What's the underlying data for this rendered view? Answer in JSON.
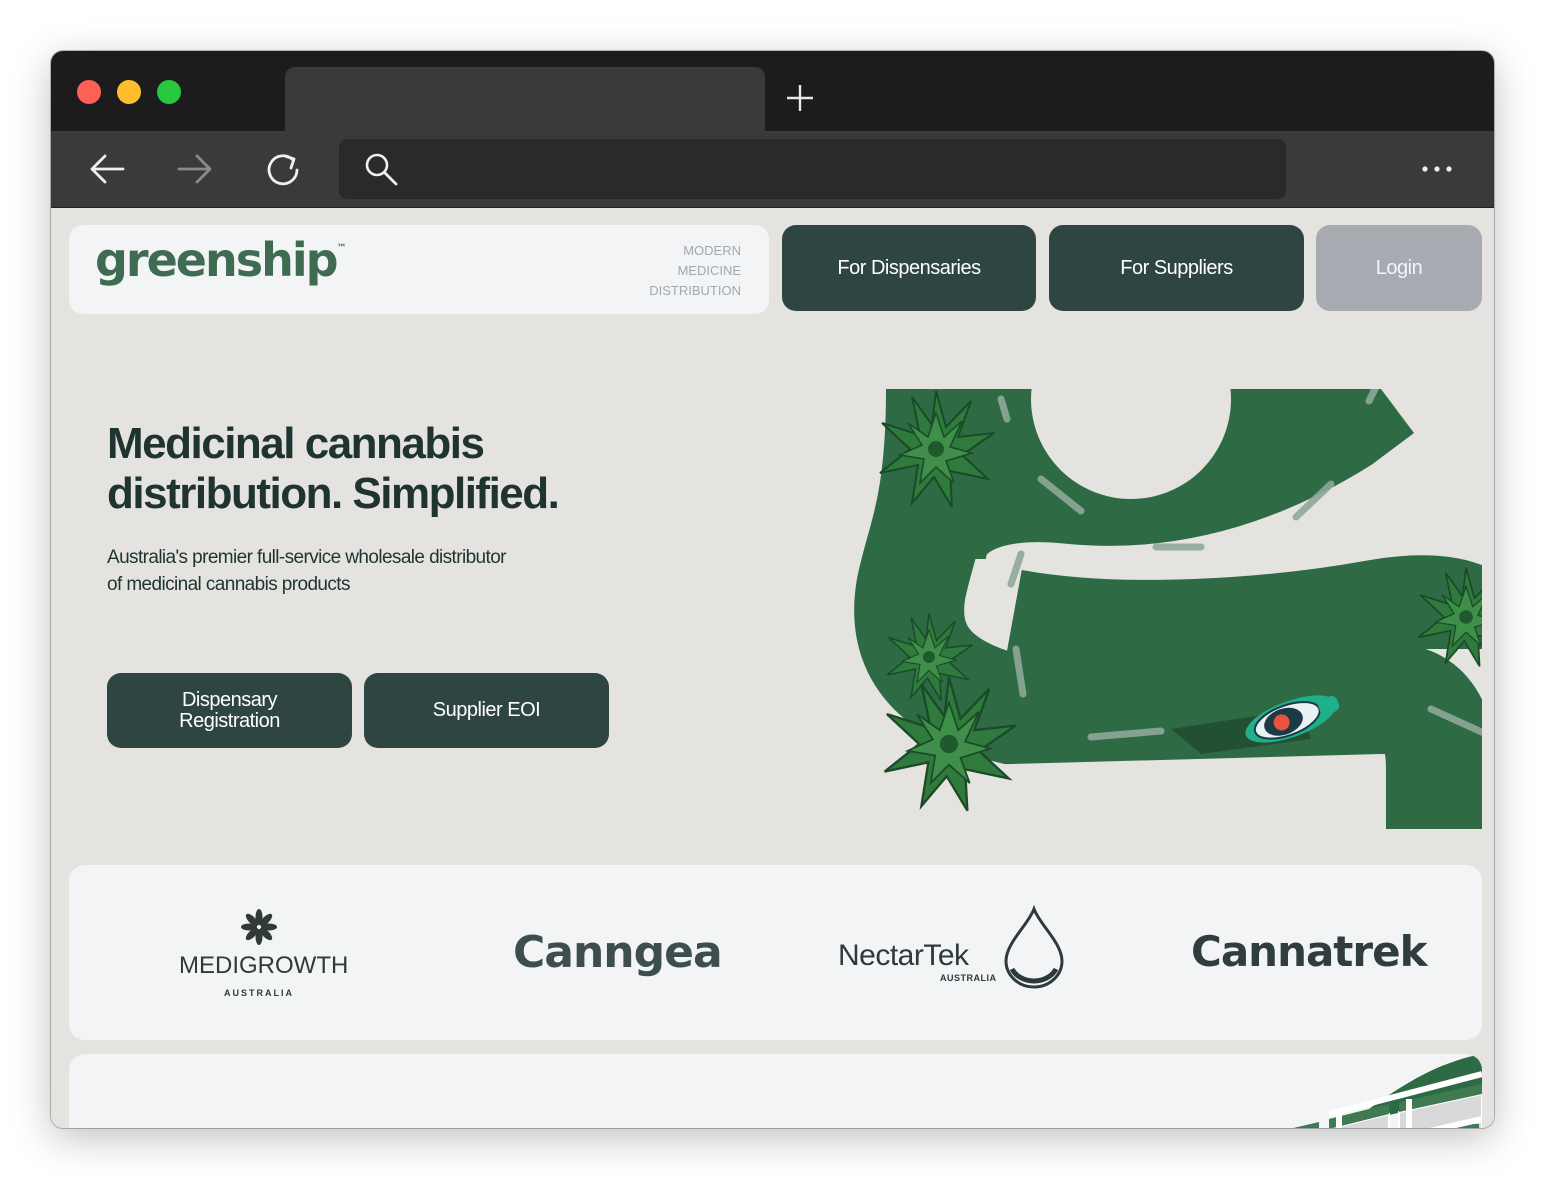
{
  "browser": {
    "icons": [
      "close-dot",
      "minimize-dot",
      "maximize-dot",
      "plus-icon",
      "back-arrow-icon",
      "forward-arrow-icon",
      "reload-icon",
      "search-icon",
      "more-icon"
    ],
    "address_value": ""
  },
  "header": {
    "logo_text": "greenship",
    "logo_tm": "™",
    "tagline": [
      "MODERN",
      "MEDICINE",
      "DISTRIBUTION"
    ],
    "nav": {
      "dispensaries": "For Dispensaries",
      "suppliers": "For Suppliers",
      "login": "Login"
    }
  },
  "hero": {
    "title_line1": "Medicinal cannabis",
    "title_line2": "distribution. Simplified.",
    "subtitle_line1": "Australia's premier full-service wholesale distributor",
    "subtitle_line2": "of medicinal cannabis products",
    "cta_dispensary_line1": "Dispensary",
    "cta_dispensary_line2": "Registration",
    "cta_supplier": "Supplier EOI"
  },
  "partners": {
    "medigrowth": "MEDIGROWTH",
    "medigrowth_sub": "AUSTRALIA",
    "canngea": "Canngea",
    "nectartek": "NectarTek",
    "nectartek_sub": "AUSTRALIA",
    "cannatrek": "Cannatrek"
  },
  "colors": {
    "brand_green": "#3f6b52",
    "button_dark": "#2f4541",
    "login_grey": "#a8aab2",
    "road_green": "#2e6b45",
    "page_bg": "#e4e3e0"
  }
}
